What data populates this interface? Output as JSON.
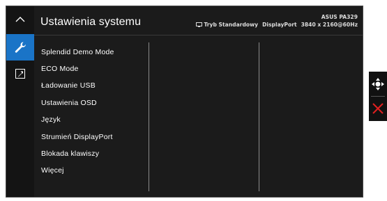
{
  "osd": {
    "title": "Ustawienia systemu",
    "header": {
      "model": "ASUS PA329",
      "mode": "Tryb Standardowy",
      "input": "DisplayPort",
      "resolution": "3840 x 2160@60Hz"
    },
    "menu_items": [
      {
        "label": "Splendid Demo Mode"
      },
      {
        "label": "ECO Mode"
      },
      {
        "label": "Ładowanie USB"
      },
      {
        "label": "Ustawienia OSD"
      },
      {
        "label": "Język"
      },
      {
        "label": "Strumień DisplayPort"
      },
      {
        "label": "Blokada klawiszy"
      },
      {
        "label": "Więcej"
      }
    ],
    "rail": {
      "up_icon": "chevron-up-icon",
      "active_icon": "wrench-icon",
      "shortcut_icon": "arrow-up-right-icon"
    },
    "side_panel": {
      "move_icon": "four-way-arrow-icon",
      "exit_icon": "close-icon"
    },
    "colors": {
      "accent": "#1a74c7",
      "background": "#1b1b1b",
      "exit": "#e02020"
    }
  }
}
